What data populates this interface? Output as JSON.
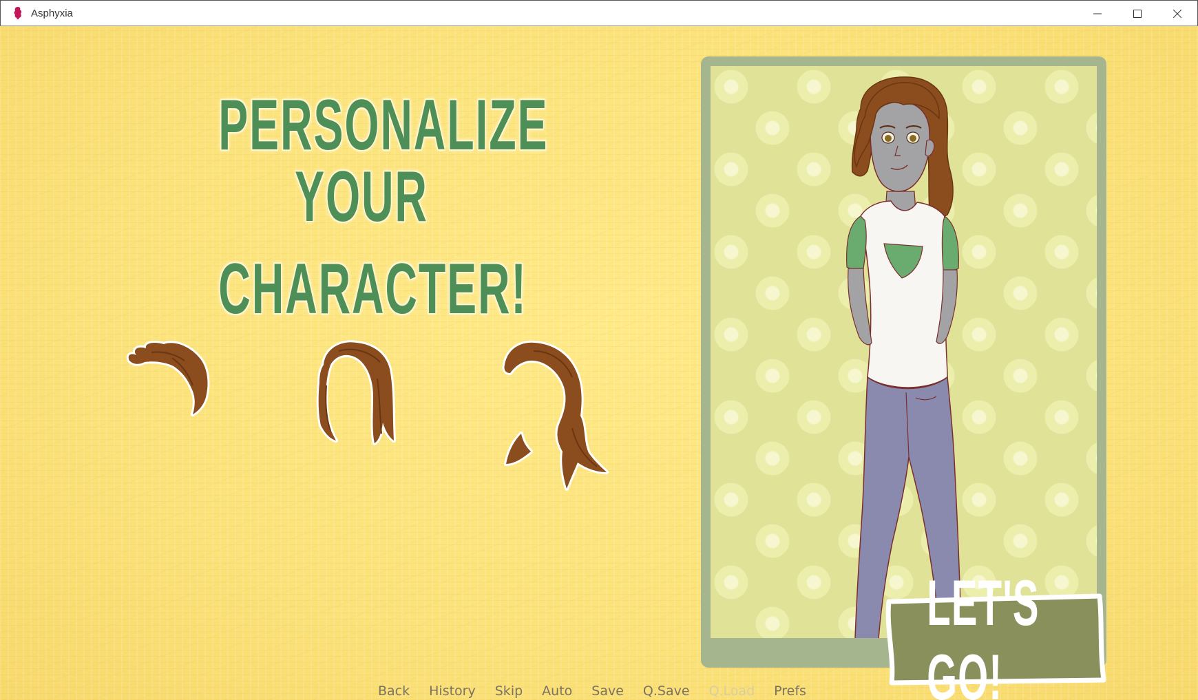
{
  "window": {
    "title": "Asphyxia",
    "controls": [
      "minimize",
      "maximize",
      "close"
    ]
  },
  "screen": {
    "heading_line1": "Personalize your",
    "heading_line2": "character!"
  },
  "hair_options": [
    {
      "id": "short-hair",
      "icon": "short-hair-icon"
    },
    {
      "id": "long-hair",
      "icon": "long-hair-icon"
    },
    {
      "id": "ponytail-hair",
      "icon": "ponytail-hair-icon"
    }
  ],
  "portrait": {
    "icon": "character-portrait",
    "colors": {
      "hair": "#8b4d1d",
      "skin": "#a3a3a6",
      "shirt": "#f8f6f2",
      "sleeves": "#6aac70",
      "pants": "#8a8aae",
      "frame": "#a5b68f",
      "background": "#dfe297"
    }
  },
  "confirm_button": {
    "label": "LET'S GO!",
    "color": "#8a905c"
  },
  "quick_menu": [
    {
      "label": "Back",
      "enabled": true
    },
    {
      "label": "History",
      "enabled": true
    },
    {
      "label": "Skip",
      "enabled": true
    },
    {
      "label": "Auto",
      "enabled": true
    },
    {
      "label": "Save",
      "enabled": true
    },
    {
      "label": "Q.Save",
      "enabled": true
    },
    {
      "label": "Q.Load",
      "enabled": false
    },
    {
      "label": "Prefs",
      "enabled": true
    }
  ],
  "theme": {
    "background": "#fbe37a",
    "heading_color": "#4e8f58",
    "menu_text": "#7b7362",
    "menu_disabled": "#d8cf9f"
  }
}
